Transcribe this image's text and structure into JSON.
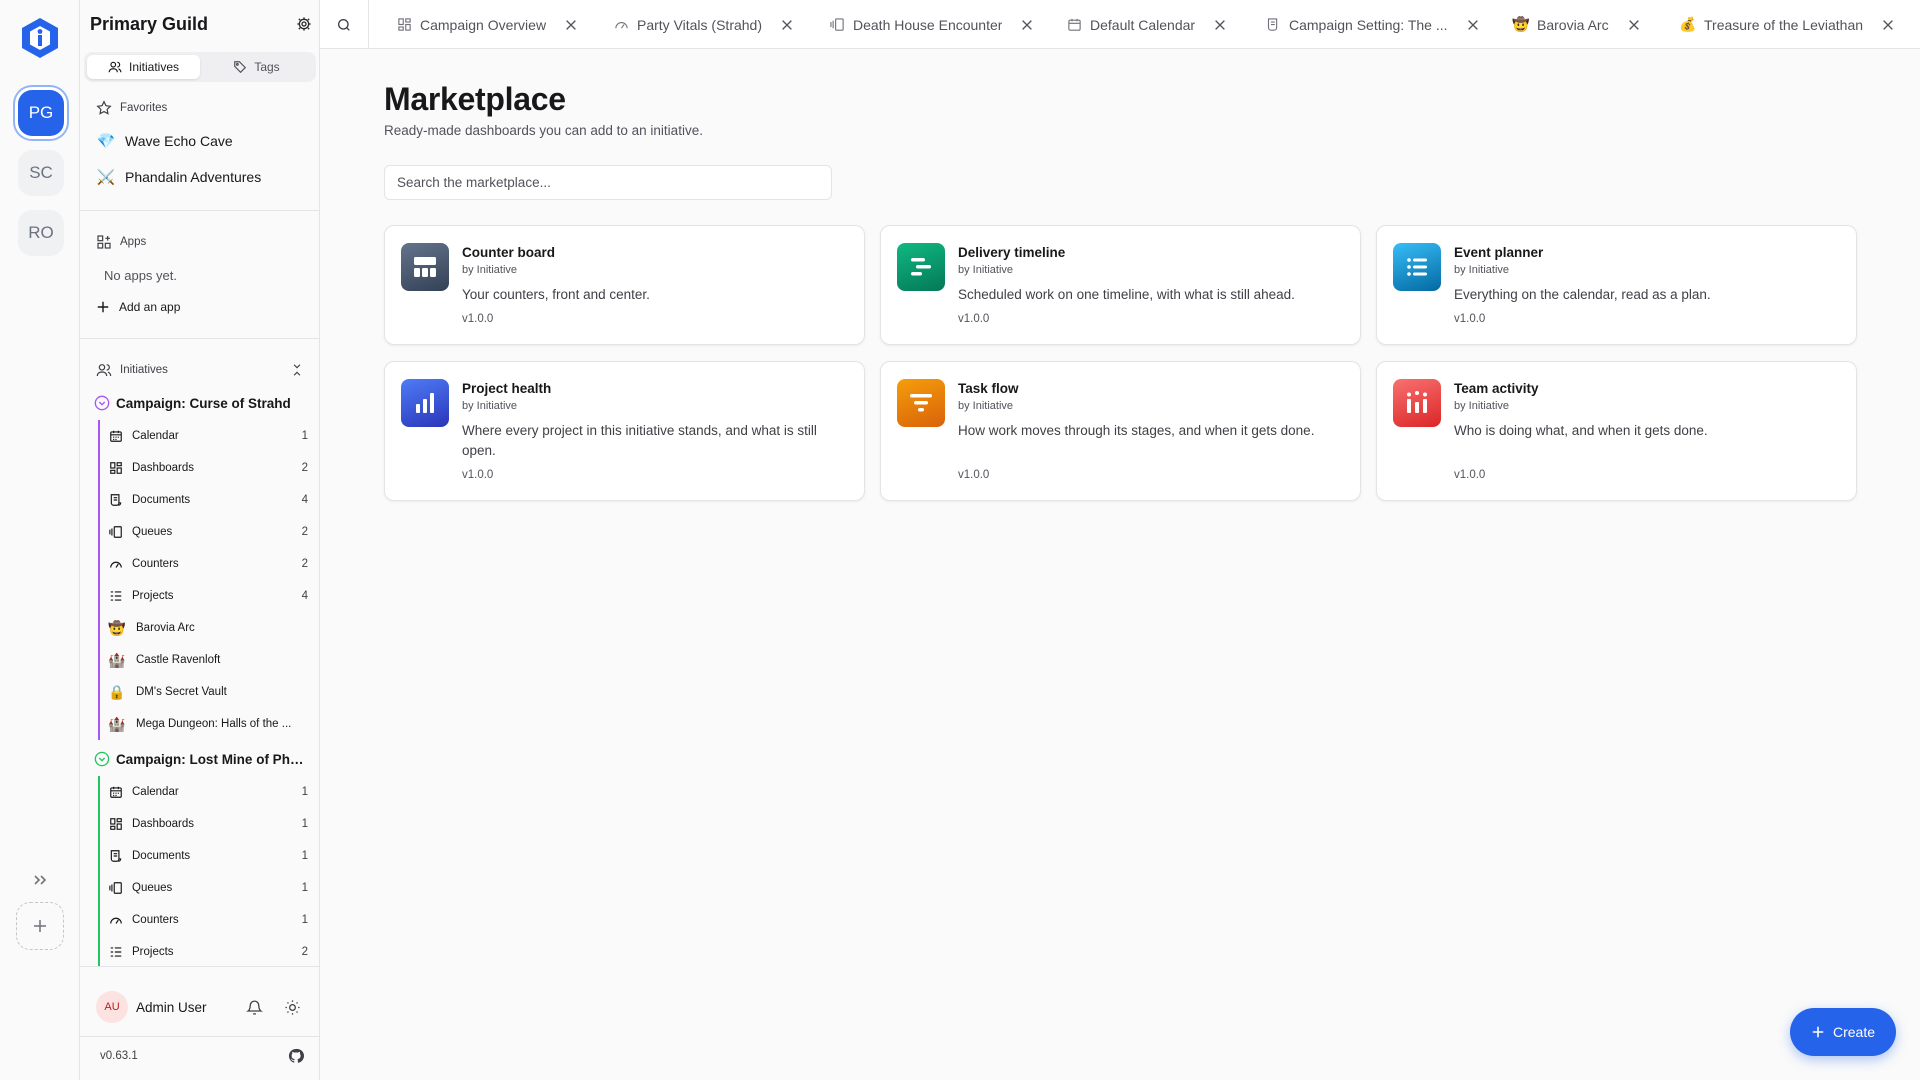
{
  "app": {
    "guild_name": "Primary Guild",
    "version": "v0.63.1"
  },
  "rail": {
    "guilds": [
      {
        "initials": "PG",
        "active": true
      },
      {
        "initials": "SC",
        "active": false
      },
      {
        "initials": "RO",
        "active": false
      }
    ]
  },
  "sidebar": {
    "tabs": {
      "initiatives": "Initiatives",
      "tags": "Tags"
    },
    "favorites": {
      "label": "Favorites",
      "items": [
        {
          "emoji": "💎",
          "label": "Wave Echo Cave"
        },
        {
          "emoji": "⚔️",
          "label": "Phandalin Adventures"
        }
      ]
    },
    "apps": {
      "label": "Apps",
      "empty": "No apps yet.",
      "add": "Add an app"
    },
    "initiatives": {
      "label": "Initiatives",
      "campaigns": [
        {
          "name": "Campaign: Curse of Strahd",
          "color": "#a855f7",
          "items": [
            {
              "icon": "calendar-icon",
              "label": "Calendar",
              "count": "1"
            },
            {
              "icon": "dashboards-icon",
              "label": "Dashboards",
              "count": "2"
            },
            {
              "icon": "documents-icon",
              "label": "Documents",
              "count": "4"
            },
            {
              "icon": "queues-icon",
              "label": "Queues",
              "count": "2"
            },
            {
              "icon": "counters-icon",
              "label": "Counters",
              "count": "2"
            },
            {
              "icon": "projects-icon",
              "label": "Projects",
              "count": "4"
            }
          ],
          "projects": [
            {
              "emoji": "🤠",
              "label": "Barovia Arc"
            },
            {
              "emoji": "🏰",
              "label": "Castle Ravenloft"
            },
            {
              "emoji": "🔒",
              "label": "DM's Secret Vault"
            },
            {
              "emoji": "🏰",
              "label": "Mega Dungeon: Halls of the ..."
            }
          ]
        },
        {
          "name": "Campaign: Lost Mine of Pha...",
          "color": "#22c55e",
          "items": [
            {
              "icon": "calendar-icon",
              "label": "Calendar",
              "count": "1"
            },
            {
              "icon": "dashboards-icon",
              "label": "Dashboards",
              "count": "1"
            },
            {
              "icon": "documents-icon",
              "label": "Documents",
              "count": "1"
            },
            {
              "icon": "queues-icon",
              "label": "Queues",
              "count": "1"
            },
            {
              "icon": "counters-icon",
              "label": "Counters",
              "count": "1"
            },
            {
              "icon": "projects-icon",
              "label": "Projects",
              "count": "2"
            }
          ]
        }
      ]
    },
    "user": {
      "initials": "AU",
      "name": "Admin User"
    }
  },
  "tabs": [
    {
      "icon": "dashboards-icon",
      "label": "Campaign Overview"
    },
    {
      "icon": "counters-icon",
      "label": "Party Vitals (Strahd)"
    },
    {
      "icon": "queues-icon",
      "label": "Death House Encounter"
    },
    {
      "icon": "calendar-icon",
      "label": "Default Calendar"
    },
    {
      "icon": "documents-icon",
      "label": "Campaign Setting: The ..."
    },
    {
      "icon": "emoji",
      "emoji": "🤠",
      "label": "Barovia Arc"
    },
    {
      "icon": "emoji",
      "emoji": "💰",
      "label": "Treasure of the Leviathan"
    }
  ],
  "main": {
    "title": "Marketplace",
    "subtitle": "Ready-made dashboards you can add to an initiative.",
    "search_placeholder": "Search the marketplace...",
    "cards": [
      {
        "name": "Counter board",
        "by": "by Initiative",
        "desc": "Your counters, front and center.",
        "version": "v1.0.0",
        "icon": "counter-board-icon",
        "color": "#475569"
      },
      {
        "name": "Delivery timeline",
        "by": "by Initiative",
        "desc": "Scheduled work on one timeline, with what is still ahead.",
        "version": "v1.0.0",
        "icon": "timeline-icon",
        "color": "#059669"
      },
      {
        "name": "Event planner",
        "by": "by Initiative",
        "desc": "Everything on the calendar, read as a plan.",
        "version": "v1.0.0",
        "icon": "list-icon",
        "color": "#0ea5e9"
      },
      {
        "name": "Project health",
        "by": "by Initiative",
        "desc": "Where every project in this initiative stands, and what is still open.",
        "version": "v1.0.0",
        "icon": "bar-chart-icon",
        "color": "#3b5bdb"
      },
      {
        "name": "Task flow",
        "by": "by Initiative",
        "desc": "How work moves through its stages, and when it gets done.",
        "version": "v1.0.0",
        "icon": "funnel-icon",
        "color": "#f59e0b"
      },
      {
        "name": "Team activity",
        "by": "by Initiative",
        "desc": "Who is doing what, and when it gets done.",
        "version": "v1.0.0",
        "icon": "activity-icon",
        "color": "#ef4444"
      }
    ],
    "create_label": "Create"
  }
}
